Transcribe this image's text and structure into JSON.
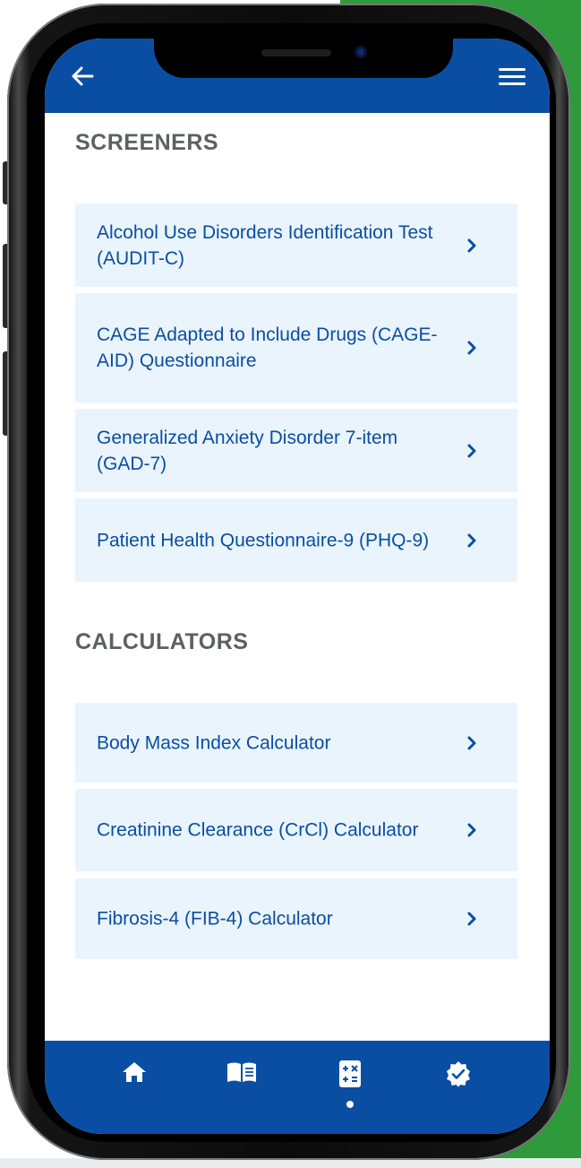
{
  "colors": {
    "brand_blue": "#0a4ea3",
    "card_background": "#eaf4fd",
    "heading_gray": "#5d5f63",
    "backdrop_green": "#2f9a3c"
  },
  "header": {
    "back_icon": "arrow-left-icon",
    "menu_icon": "hamburger-menu-icon"
  },
  "sections": {
    "screeners": {
      "title": "SCREENERS",
      "items": [
        {
          "label": "Alcohol Use Disorders Identification Test (AUDIT-C)",
          "icon": "chevron-right-icon"
        },
        {
          "label": "CAGE Adapted to Include Drugs (CAGE-AID) Questionnaire",
          "icon": "chevron-right-icon"
        },
        {
          "label": "Generalized Anxiety Disorder 7-item (GAD-7)",
          "icon": "chevron-right-icon"
        },
        {
          "label": "Patient Health Questionnaire-9 (PHQ-9)",
          "icon": "chevron-right-icon"
        }
      ]
    },
    "calculators": {
      "title": "CALCULATORS",
      "items": [
        {
          "label": "Body Mass Index Calculator",
          "icon": "chevron-right-icon"
        },
        {
          "label": "Creatinine Clearance (CrCl) Calculator",
          "icon": "chevron-right-icon"
        },
        {
          "label": "Fibrosis-4 (FIB-4) Calculator",
          "icon": "chevron-right-icon"
        }
      ]
    }
  },
  "bottom_nav": {
    "items": [
      {
        "icon": "home-icon",
        "active": false
      },
      {
        "icon": "book-icon",
        "active": false
      },
      {
        "icon": "calculator-icon",
        "active": true
      },
      {
        "icon": "verified-badge-icon",
        "active": false
      }
    ]
  }
}
